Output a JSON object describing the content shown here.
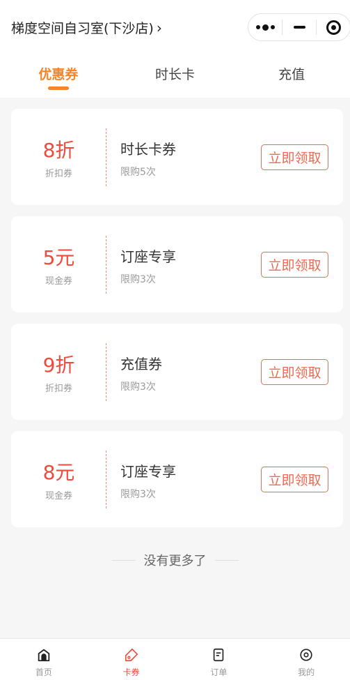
{
  "header": {
    "store_name": "梯度空间自习室(下沙店)",
    "chevron": "›",
    "capsule": {
      "more_icon": "more-dots-icon",
      "minimize_icon": "minimize-icon",
      "close_icon": "target-circle-icon"
    }
  },
  "tabs": [
    {
      "label": "优惠券",
      "active": true
    },
    {
      "label": "时长卡",
      "active": false
    },
    {
      "label": "充值",
      "active": false
    }
  ],
  "coupons": [
    {
      "amount": "8折",
      "type": "折扣券",
      "name": "时长卡券",
      "limit": "限购5次",
      "button": "立即领取"
    },
    {
      "amount": "5元",
      "type": "现金券",
      "name": "订座专享",
      "limit": "限购3次",
      "button": "立即领取"
    },
    {
      "amount": "9折",
      "type": "折扣券",
      "name": "充值券",
      "limit": "限购3次",
      "button": "立即领取"
    },
    {
      "amount": "8元",
      "type": "现金券",
      "name": "订座专享",
      "limit": "限购3次",
      "button": "立即领取"
    }
  ],
  "end_note": "没有更多了",
  "bottom_nav": [
    {
      "label": "首页",
      "icon": "home-icon",
      "active": false
    },
    {
      "label": "卡券",
      "icon": "coupon-tag-icon",
      "active": true
    },
    {
      "label": "订单",
      "icon": "order-doc-icon",
      "active": false
    },
    {
      "label": "我的",
      "icon": "profile-circle-icon",
      "active": false
    }
  ],
  "colors": {
    "accent": "#f5842a",
    "price_red": "#ef4a3c",
    "button_border": "#ec6a50"
  }
}
